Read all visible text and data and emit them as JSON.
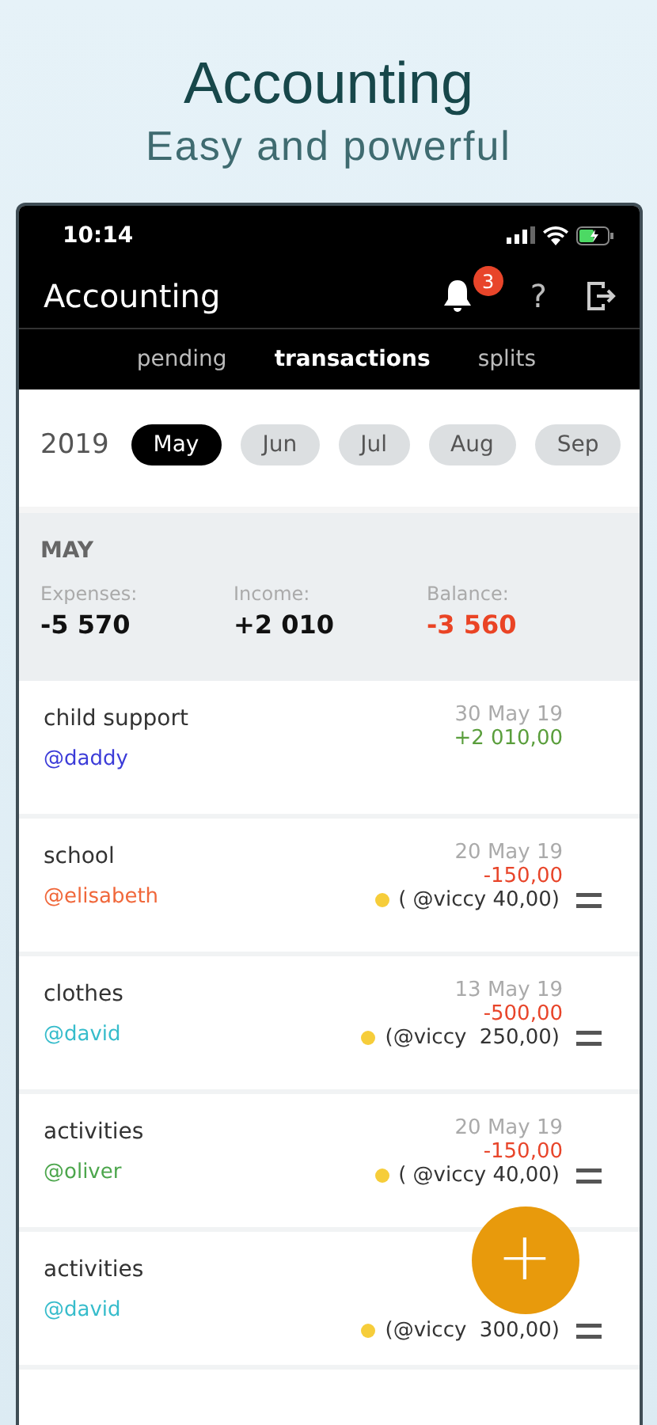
{
  "promo": {
    "title": "Accounting",
    "subtitle": "Easy and powerful"
  },
  "status_bar": {
    "time": "10:14"
  },
  "app_bar": {
    "title": "Accounting",
    "notification_count": "3",
    "help": "?"
  },
  "tabs": [
    {
      "label": "pending",
      "selected": false
    },
    {
      "label": "transactions",
      "selected": true
    },
    {
      "label": "splits",
      "selected": false
    }
  ],
  "year": "2019",
  "months": [
    {
      "label": "May",
      "selected": true
    },
    {
      "label": "Jun",
      "selected": false
    },
    {
      "label": "Jul",
      "selected": false
    },
    {
      "label": "Aug",
      "selected": false
    },
    {
      "label": "Sep",
      "selected": false
    }
  ],
  "summary": {
    "month": "MAY",
    "stats": [
      {
        "label": "Expenses:",
        "value": "-5 570",
        "negative": false
      },
      {
        "label": "Income:",
        "value": "+2 010",
        "negative": false
      },
      {
        "label": "Balance:",
        "value": "-3 560",
        "negative": true
      }
    ]
  },
  "transactions": [
    {
      "title": "child support",
      "handle": "@daddy",
      "color": "#3b3bd8",
      "date": "30 May 19",
      "amount": "+2 010,00",
      "income": true
    },
    {
      "title": "school",
      "handle": "@elisabeth",
      "color": "#f0673a",
      "date": "20 May 19",
      "amount": "-150,00",
      "income": false,
      "split": "( @viccy 40,00)"
    },
    {
      "title": "clothes",
      "handle": "@david",
      "color": "#36bccb",
      "date": "13 May 19",
      "amount": "-500,00",
      "income": false,
      "split": "(@viccy  250,00)"
    },
    {
      "title": "activities",
      "handle": "@oliver",
      "color": "#4ca64c",
      "date": "20 May 19",
      "amount": "-150,00",
      "income": false,
      "split": "( @viccy 40,00)"
    },
    {
      "title": "activities",
      "handle": "@david",
      "color": "#36bccb",
      "split": "(@viccy  300,00)"
    }
  ],
  "fab": "+"
}
